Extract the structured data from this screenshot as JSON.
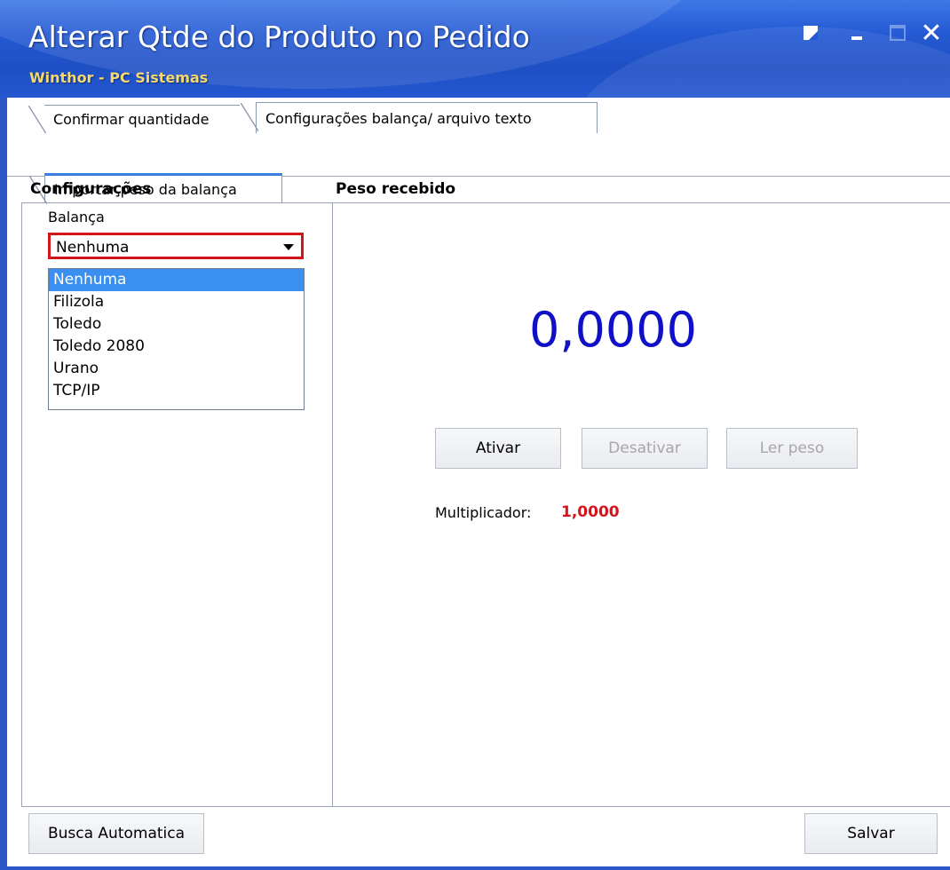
{
  "window": {
    "title": "Alterar Qtde do Produto no Pedido",
    "subtitle": "Winthor - PC Sistemas",
    "controls": [
      "restore-icon",
      "minimize-icon",
      "maximize-icon",
      "close-icon"
    ],
    "close_glyph": "✕"
  },
  "tabs": {
    "row1": [
      {
        "label": "Confirmar quantidade"
      },
      {
        "label": "Configurações balança/ arquivo texto"
      }
    ],
    "row2": [
      {
        "label": "Importar peso da balança"
      }
    ]
  },
  "config": {
    "header": "Configurações",
    "balanca_label": "Balança",
    "balanca_value": "Nenhuma",
    "options": [
      "Nenhuma",
      "Filizola",
      "Toledo",
      "Toledo 2080",
      "Urano",
      "TCP/IP"
    ],
    "selected_option": "Nenhuma"
  },
  "peso": {
    "header": "Peso recebido",
    "value": "0,0000",
    "buttons": {
      "ativar": "Ativar",
      "desativar": "Desativar",
      "ler_peso": "Ler peso"
    },
    "multiplicador_label": "Multiplicador:",
    "multiplicador_value": "1,0000"
  },
  "footer": {
    "busca": "Busca Automatica",
    "salvar": "Salvar"
  },
  "colors": {
    "titlebar": "#2459d3",
    "peso_value": "#1010c8",
    "highlight_red": "#d4141b",
    "selection": "#3a8ff0"
  }
}
